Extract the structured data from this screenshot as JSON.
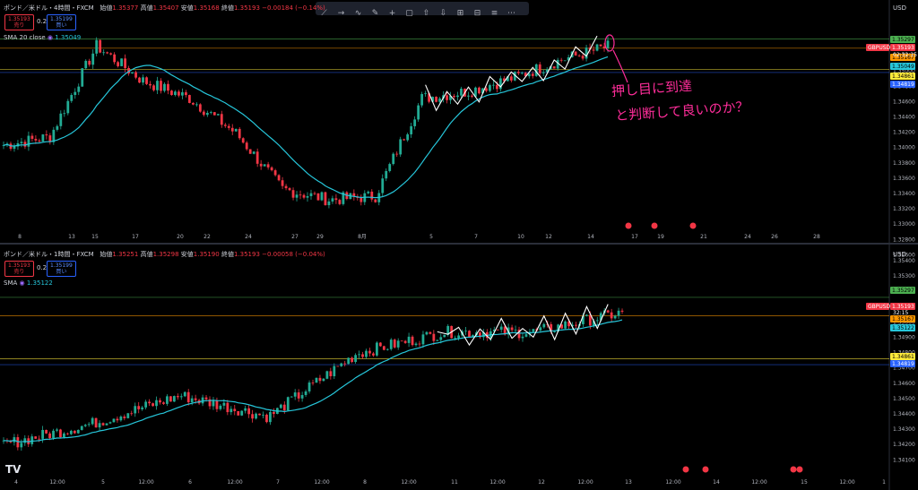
{
  "top": {
    "title": "ポンド／米ドル・4時間・FXCM",
    "ohlc_labels": [
      "始値",
      "高値",
      "安値",
      "終値"
    ],
    "ohlc_values": [
      "1.35377",
      "1.35407",
      "1.35168",
      "1.35193"
    ],
    "change": "−0.00184 (−0.14%)",
    "sell_price": "1.35193",
    "sell_label": "売り",
    "spread": "0.2",
    "buy_price": "1.35199",
    "buy_label": "買い",
    "sma_label": "SMA 20 close",
    "sma_value": "1.35049",
    "currency": "USD",
    "symbol": "GBPUSD",
    "countdown": "02:32:15",
    "price_ticks": [
      "1.35400",
      "1.35200",
      "1.35000",
      "1.34800",
      "1.34600",
      "1.34400",
      "1.34200",
      "1.34000",
      "1.33800",
      "1.33600",
      "1.33400",
      "1.33200",
      "1.33000",
      "1.32800",
      "1.32600"
    ],
    "price_tags": [
      {
        "text": "1.35297",
        "color": "#4caf50"
      },
      {
        "text": "1.35193",
        "color": "#f23645"
      },
      {
        "text": "1.35167",
        "color": "#ff9800"
      },
      {
        "text": "1.35049",
        "color": "#26c6da"
      },
      {
        "text": "1.34861",
        "color": "#ffeb3b"
      },
      {
        "text": "1.34819",
        "color": "#2962ff"
      }
    ],
    "time_ticks": [
      "8",
      "13",
      "15",
      "17",
      "20",
      "22",
      "24",
      "27",
      "29",
      "8月",
      "5",
      "7",
      "10",
      "12",
      "14",
      "17",
      "19",
      "21",
      "24",
      "26",
      "28"
    ]
  },
  "bottom": {
    "title": "ポンド／米ドル・1時間・FXCM",
    "ohlc_labels": [
      "始値",
      "高値",
      "安値",
      "終値"
    ],
    "ohlc_values": [
      "1.35251",
      "1.35298",
      "1.35190",
      "1.35193"
    ],
    "change": "−0.00058 (−0.04%)",
    "sell_price": "1.35193",
    "sell_label": "売り",
    "spread": "0.2",
    "buy_price": "1.35199",
    "buy_label": "買い",
    "sma_label": "SMA",
    "sma_value": "1.35122",
    "currency": "USD",
    "symbol": "GBPUSD",
    "countdown": "32:15",
    "price_ticks": [
      "1.35400",
      "1.35300",
      "1.35200",
      "1.35100",
      "1.35000",
      "1.34900",
      "1.34800",
      "1.34700",
      "1.34600",
      "1.34500",
      "1.34400",
      "1.34300",
      "1.34200",
      "1.34100"
    ],
    "price_tags": [
      {
        "text": "1.35297",
        "color": "#4caf50"
      },
      {
        "text": "1.35193",
        "color": "#f23645"
      },
      {
        "text": "1.35167",
        "color": "#ff9800"
      },
      {
        "text": "1.35122",
        "color": "#26c6da"
      },
      {
        "text": "1.34861",
        "color": "#ffeb3b"
      },
      {
        "text": "1.34819",
        "color": "#2962ff"
      }
    ],
    "time_ticks": [
      "4",
      "12:00",
      "5",
      "12:00",
      "6",
      "12:00",
      "7",
      "12:00",
      "8",
      "12:00",
      "11",
      "12:00",
      "12",
      "12:00",
      "13",
      "12:00",
      "14",
      "12:00",
      "15",
      "12:00",
      "1"
    ]
  },
  "annotation": {
    "line1": "押し目に到達",
    "line2": "と判断して良いのか？"
  },
  "logo": "TV",
  "chart_data": [
    {
      "type": "candlestick",
      "title": "ポンド／米ドル・4時間・FXCM",
      "x": [
        "Jul 8",
        "Jul 13",
        "Jul 15",
        "Jul 17",
        "Jul 20",
        "Jul 22",
        "Jul 24",
        "Jul 27",
        "Jul 29",
        "Aug 1",
        "Aug 5",
        "Aug 7",
        "Aug 10",
        "Aug 12"
      ],
      "close_approx": [
        1.3378,
        1.339,
        1.352,
        1.347,
        1.3445,
        1.3395,
        1.3315,
        1.33,
        1.3305,
        1.3445,
        1.3455,
        1.3475,
        1.35,
        1.3519
      ],
      "series": [
        {
          "name": "SMA 20 close",
          "last": 1.35049
        }
      ],
      "ylim": [
        1.3255,
        1.356
      ],
      "levels": [
        1.35297,
        1.35193,
        1.35167,
        1.35049,
        1.34861,
        1.34819
      ]
    },
    {
      "type": "candlestick",
      "title": "ポンド／米ドル・1時間・FXCM",
      "x": [
        "Aug 4",
        "Aug 5",
        "Aug 6",
        "Aug 7",
        "Aug 8",
        "Aug 11",
        "Aug 12",
        "Aug 13"
      ],
      "close_approx": [
        1.3425,
        1.344,
        1.346,
        1.3445,
        1.349,
        1.3505,
        1.3505,
        1.3519
      ],
      "series": [
        {
          "name": "SMA",
          "last": 1.35122
        }
      ],
      "ylim": [
        1.3405,
        1.355
      ],
      "levels": [
        1.35297,
        1.35193,
        1.35167,
        1.35122,
        1.34861,
        1.34819
      ]
    }
  ]
}
